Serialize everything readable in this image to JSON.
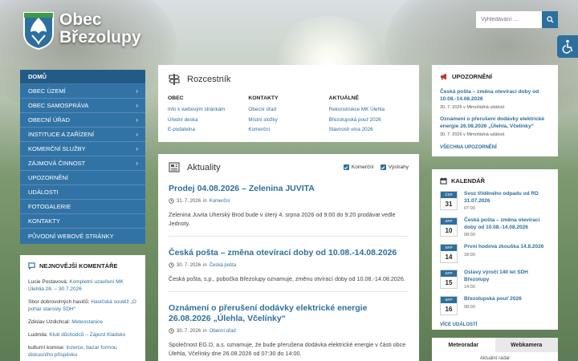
{
  "header": {
    "title_line1": "Obec",
    "title_line2": "Březolupy",
    "search_placeholder": "Vyhledávání ..."
  },
  "colors": {
    "primary": "#3273a6",
    "accent": "#2d6f9e",
    "alert": "#c0392b"
  },
  "nav": {
    "items": [
      {
        "label": "DOMŮ",
        "chev": ""
      },
      {
        "label": "OBEC ÚZEMÍ",
        "chev": "›"
      },
      {
        "label": "OBEC SAMOSPRÁVA",
        "chev": "›"
      },
      {
        "label": "OBECNÍ ÚŘAD",
        "chev": "›"
      },
      {
        "label": "INSTITUCE A ZAŘÍZENÍ",
        "chev": "›"
      },
      {
        "label": "KOMERČNÍ SLUŽBY",
        "chev": "›"
      },
      {
        "label": "ZÁJMOVÁ ČINNOST",
        "chev": "›"
      },
      {
        "label": "UPOZORNĚNÍ",
        "chev": ""
      },
      {
        "label": "UDÁLOSTI",
        "chev": ""
      },
      {
        "label": "FOTOGALERIE",
        "chev": ""
      },
      {
        "label": "KONTAKTY",
        "chev": ""
      },
      {
        "label": "PŮVODNÍ WEBOVÉ STRÁNKY",
        "chev": ""
      }
    ]
  },
  "comments": {
    "title": "NEJNOVĚJŠÍ KOMENTÁŘE",
    "items": [
      {
        "author": "Lucie Postavová:",
        "link": "Kompletní uzavření MK Úlehlia 28. – 30.7.2026"
      },
      {
        "author": "Sbor dobrovolných hasičů:",
        "link": "Hasičská soutěž „O pohár starosty SDH“"
      },
      {
        "author": "Zdislav Uzdichcal:",
        "link": "Meteostanice"
      },
      {
        "author": "Ludmila:",
        "link": "Klub důchodců – Zájezd Kladsko"
      },
      {
        "author": "kulturní komise:",
        "link": "Inzerce, bazar formou diskusního příspěvku"
      }
    ]
  },
  "rozcestnik": {
    "title": "Rozcestník",
    "cols": [
      {
        "head": "OBEC",
        "links": [
          "Info k webovým stránkám",
          "Úřední deska",
          "E-podatelna"
        ]
      },
      {
        "head": "KONTAKTY",
        "links": [
          "Obecní úřad",
          "Místní složky",
          "Komerční"
        ]
      },
      {
        "head": "AKTUÁLNĚ",
        "links": [
          "Rekonstrukce MK Úlehla",
          "Březolupská pouť 2026",
          "Slavnosti vína 2026"
        ]
      }
    ]
  },
  "aktuality": {
    "title": "Aktuality",
    "filter1": "Komerční",
    "filter2": "Výstrahy",
    "news": [
      {
        "title": "Prodej 04.08.2026 – Zelenina JUVITA",
        "date": "31. 7. 2026",
        "in": "in",
        "cat": "Komerční",
        "body": "Zelenina Juvita Uherský Brod bude v úterý 4. srpna 2026 od 9:00 do 9:20 prodávat vedle Jednoty."
      },
      {
        "title": "Česká pošta – změna otevírací doby od 10.08.-14.08.2026",
        "date": "30. 7. 2026",
        "in": "in",
        "cat": "Česká pošta",
        "body": "Česká pošta, s.p., pobočka Březolupy oznamuje, změnu otvírací doby od 10.08.-14.08.2026."
      },
      {
        "title": "Oznámení o přerušení dodávky elektrické energie 26.08.2026 „Úlehla, Včelínky“",
        "date": "30. 7. 2026",
        "in": "in",
        "cat": "Obecní úřad",
        "body": "Společnost EG.D, a.s. oznamuje, že bude přerušena dodávka elektrické energie v části obce Úlehla, Včelínky dne 26.08.2026 od 07:30 do 14:00."
      }
    ]
  },
  "upozorneni": {
    "title": "UPOZORNĚNÍ",
    "items": [
      {
        "title": "Česká pošta – změna otevírací doby od 10.08.-14.08.2026",
        "meta": "30. 7. 2026 v Mimořádná událost"
      },
      {
        "title": "Oznámení o přerušení dodávky elektrické energie 26.08.2026 „Úlehla, Včelínky“",
        "meta": "30. 7. 2026 v Mimořádná událost"
      }
    ],
    "all": "VŠECHNA UPOZORNĚNÍ"
  },
  "kalendar": {
    "title": "KALENDÁŘ",
    "events": [
      {
        "mo": "ČER",
        "d": "31",
        "title": "Svoz tříděného odpadu od RD 31.07.2026",
        "time": "07:00"
      },
      {
        "mo": "SRP",
        "d": "10",
        "title": "Česká pošta – změna otevírací doby od 10.08.-14.08.2026",
        "time": "08:00"
      },
      {
        "mo": "SRP",
        "d": "14",
        "title": "První hodová zkouška 14.8.2026",
        "time": "18:00"
      },
      {
        "mo": "SRP",
        "d": "15",
        "title": "Oslavy výročí 140 let SDH Březolupy",
        "time": "14:00"
      },
      {
        "mo": "SRP",
        "d": "16",
        "title": "Březolupská pouť 2026",
        "time": "08:00"
      }
    ],
    "all": "VÍCE UDÁLOSTÍ"
  },
  "tabs": {
    "tab1": "Meteoradar",
    "tab2": "Webkamera",
    "sub": "Aktuální radar"
  }
}
